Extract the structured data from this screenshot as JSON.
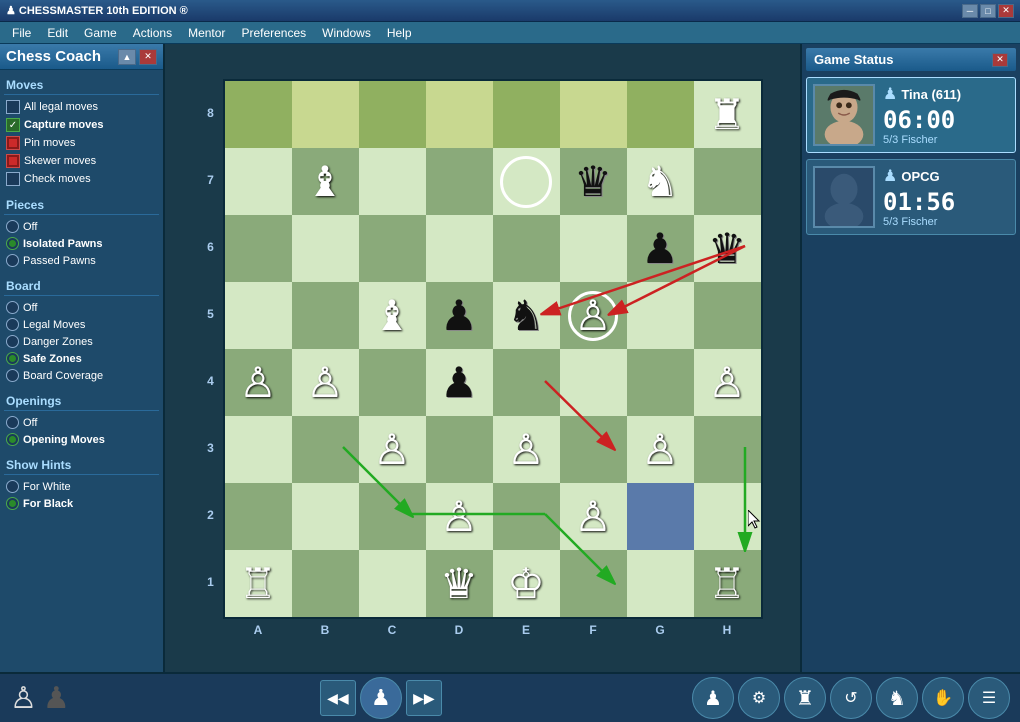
{
  "titlebar": {
    "title": "CHESSMASTER",
    "subtitle": "10th EDITION",
    "min": "─",
    "max": "□",
    "close": "✕"
  },
  "menu": {
    "items": [
      "File",
      "Edit",
      "Game",
      "Actions",
      "Mentor",
      "Preferences",
      "Windows",
      "Help"
    ]
  },
  "coach": {
    "title": "Chess Coach",
    "expand": "▲",
    "close": "✕",
    "sections": {
      "moves": "Moves",
      "pieces": "Pieces",
      "board": "Board",
      "openings": "Openings",
      "hints": "Show Hints"
    },
    "moves_items": [
      {
        "label": "All legal moves",
        "type": "checkbox",
        "checked": false
      },
      {
        "label": "Capture moves",
        "type": "checkbox",
        "checked": true
      },
      {
        "label": "Pin moves",
        "type": "checkbox",
        "checked": true,
        "red": true
      },
      {
        "label": "Skewer moves",
        "type": "checkbox",
        "checked": true,
        "red": true
      },
      {
        "label": "Check moves",
        "type": "checkbox",
        "checked": false
      }
    ],
    "pieces_items": [
      {
        "label": "Off",
        "type": "radio",
        "checked": false
      },
      {
        "label": "Isolated Pawns",
        "type": "radio",
        "checked": true
      },
      {
        "label": "Passed Pawns",
        "type": "radio",
        "checked": false
      }
    ],
    "board_items": [
      {
        "label": "Off",
        "type": "radio",
        "checked": false
      },
      {
        "label": "Legal Moves",
        "type": "radio",
        "checked": false
      },
      {
        "label": "Danger Zones",
        "type": "radio",
        "checked": false
      },
      {
        "label": "Safe Zones",
        "type": "radio",
        "checked": true
      },
      {
        "label": "Board Coverage",
        "type": "radio",
        "checked": false
      }
    ],
    "openings_items": [
      {
        "label": "Off",
        "type": "radio",
        "checked": false
      },
      {
        "label": "Opening Moves",
        "type": "radio",
        "checked": true
      }
    ],
    "hints_items": [
      {
        "label": "For White",
        "type": "radio",
        "checked": false
      },
      {
        "label": "For Black",
        "type": "radio",
        "checked": true
      }
    ]
  },
  "board": {
    "ranks": [
      "8",
      "7",
      "6",
      "5",
      "4",
      "3",
      "2",
      "1"
    ],
    "files": [
      "A",
      "B",
      "C",
      "D",
      "E",
      "F",
      "G",
      "H"
    ]
  },
  "gamestatus": {
    "title": "Game Status",
    "close": "✕",
    "player1": {
      "name": "Tina (611)",
      "time": "06:00",
      "level": "5/3 Fischer",
      "active": true
    },
    "player2": {
      "name": "OPCG",
      "time": "01:56",
      "level": "5/3 Fischer",
      "active": false
    }
  },
  "bottom": {
    "nav_prev_prev": "⏮",
    "nav_prev": "◀",
    "nav_play": "♟",
    "nav_next": "▶",
    "nav_next_next": "⏭",
    "icons": [
      "♟",
      "⚙",
      "♜",
      "↺",
      "♞",
      "✋",
      "☰"
    ]
  }
}
